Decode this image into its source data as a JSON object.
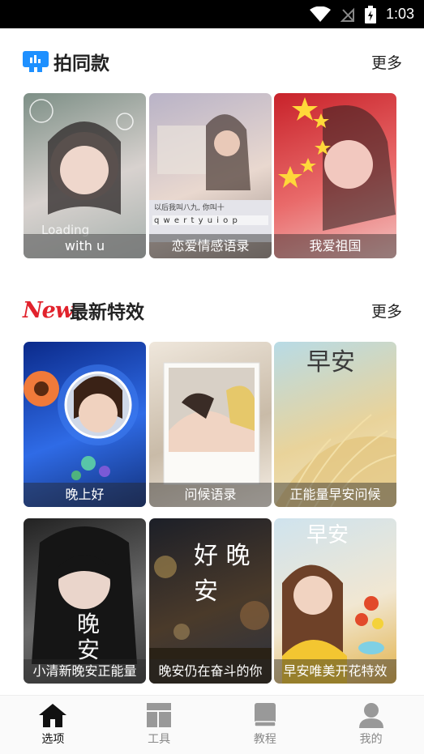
{
  "status_bar": {
    "time": "1:03"
  },
  "sections": [
    {
      "title": "拍同款",
      "more": "更多",
      "cards": [
        {
          "caption": "with u",
          "overlay_text": "Loading",
          "colors": [
            "#7d8f86",
            "#d8d2cf",
            "#a7b1ad"
          ]
        },
        {
          "caption": "恋爱情感语录",
          "overlay_text": "以后我叫八九, 你叫十",
          "keyboard_row": "q w e r t y u i o p",
          "colors": [
            "#b9b3c7",
            "#e9d8cf",
            "#9c8f88"
          ]
        },
        {
          "caption": "我爱祖国",
          "colors": [
            "#c8222a",
            "#e96a6a",
            "#f3c2c0"
          ]
        }
      ]
    },
    {
      "badge": "New",
      "title": "最新特效",
      "more": "更多",
      "cards": [
        {
          "caption": "晚上好",
          "colors": [
            "#0b2a8a",
            "#2f6be6",
            "#12307a"
          ]
        },
        {
          "caption": "问候语录",
          "colors": [
            "#efe7dc",
            "#c9bba8",
            "#f6efe6"
          ]
        },
        {
          "caption": "正能量早安问候",
          "overlay_text": "早安",
          "colors": [
            "#b8dbe6",
            "#e9d39a",
            "#f0e6c7"
          ]
        },
        {
          "caption": "小清新晚安正能量",
          "overlay_text": "晚安",
          "colors": [
            "#222222",
            "#6b6b6b",
            "#3b3b3b"
          ]
        },
        {
          "caption": "晚安仍在奋斗的你",
          "overlay_text": "好 晚 安",
          "colors": [
            "#1c1f28",
            "#4a3a2a",
            "#2c3240"
          ]
        },
        {
          "caption": "早安唯美开花特效",
          "overlay_text": "早安",
          "colors": [
            "#cfe3ee",
            "#f1e7d2",
            "#e2b24a"
          ]
        }
      ]
    }
  ],
  "tabs": [
    {
      "label": "选项",
      "icon": "home-icon",
      "active": true
    },
    {
      "label": "工具",
      "icon": "layout-icon",
      "active": false
    },
    {
      "label": "教程",
      "icon": "book-icon",
      "active": false
    },
    {
      "label": "我的",
      "icon": "user-icon",
      "active": false
    }
  ],
  "colors": {
    "accent_blue": "#1e90ff",
    "new_red": "#e1222c",
    "active_tab": "#111111",
    "inactive_tab": "#999999"
  }
}
